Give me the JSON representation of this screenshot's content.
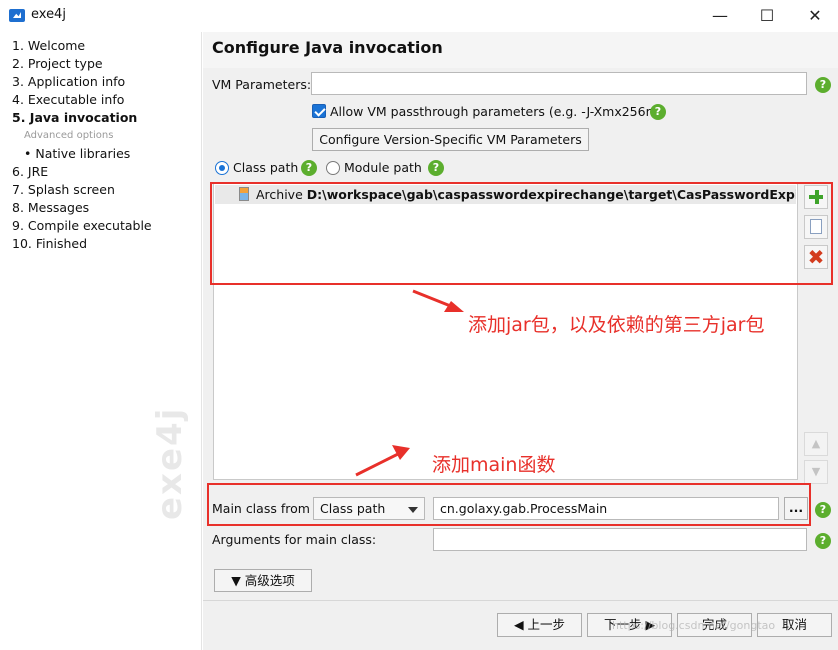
{
  "window": {
    "title": "exe4j",
    "minimize": "—",
    "maximize": "☐",
    "close": "✕"
  },
  "sidebar": {
    "steps": [
      {
        "label": "1. Welcome"
      },
      {
        "label": "2. Project type"
      },
      {
        "label": "3. Application info"
      },
      {
        "label": "4. Executable info"
      },
      {
        "label": "5. Java invocation"
      },
      {
        "label": "Advanced options"
      },
      {
        "label": "• Native libraries"
      },
      {
        "label": "6. JRE"
      },
      {
        "label": "7. Splash screen"
      },
      {
        "label": "8. Messages"
      },
      {
        "label": "9. Compile executable"
      },
      {
        "label": "10. Finished"
      }
    ],
    "watermark": "exe4j"
  },
  "main": {
    "title": "Configure Java invocation",
    "vm_params_label": "VM Parameters:",
    "vm_params_value": "",
    "passthrough_label": "Allow VM passthrough parameters (e.g. -J-Xmx256m)",
    "passthrough_checked": true,
    "version_btn": "Configure Version-Specific VM Parameters",
    "classpath_radio": "Class path",
    "modulepath_radio": "Module path",
    "classpath_entries": [
      {
        "type": "Archive",
        "path": "D:\\workspace\\gab\\caspasswordexpirechange\\target\\CasPasswordExpireChange-"
      }
    ],
    "main_class_from_label": "Main class from",
    "main_class_source": "Class path",
    "main_class_value": "cn.golaxy.gab.ProcessMain",
    "browse_btn": "...",
    "args_label": "Arguments for main class:",
    "args_value": "",
    "advanced_btn": "高级选项",
    "help": "?"
  },
  "annotations": {
    "jar": "添加jar包，以及依赖的第三方jar包",
    "main": "添加main函数",
    "color": "#e8302a"
  },
  "footer": {
    "prev": "上一步",
    "next": "下一步",
    "finish": "完成",
    "cancel": "取消",
    "watermark_url": "https://blog.csdn.net/gongtao"
  }
}
